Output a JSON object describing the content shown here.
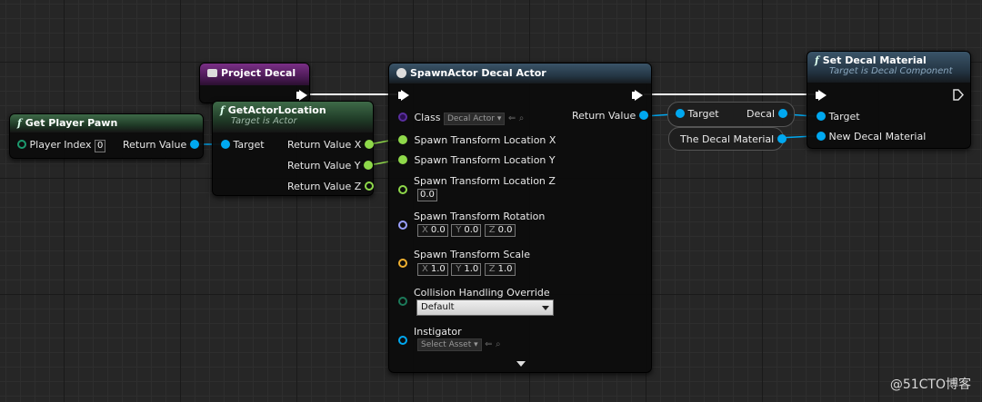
{
  "colors": {
    "exec": "#ffffff",
    "object_pin": "#00a8f0",
    "vector_pin": "#8fd94a",
    "float_pin": "#8fd94a",
    "class_pin": "#5a2ea0",
    "rotator_pin": "#9aa0ff",
    "scale_pin": "#f0b030",
    "enum_pin": "#1c7a5a"
  },
  "nodes": {
    "get_player_pawn": {
      "title": "Get Player Pawn",
      "player_index_label": "Player Index",
      "player_index_value": "0",
      "return_label": "Return Value"
    },
    "project_decal": {
      "title": "Project Decal"
    },
    "get_actor_location": {
      "title": "GetActorLocation",
      "subtitle": "Target is Actor",
      "target_label": "Target",
      "rv_x": "Return Value X",
      "rv_y": "Return Value Y",
      "rv_z": "Return Value Z"
    },
    "spawn_actor": {
      "title": "SpawnActor Decal Actor",
      "class_label": "Class",
      "class_value": "Decal Actor",
      "return_label": "Return Value",
      "loc_x": "Spawn Transform Location X",
      "loc_y": "Spawn Transform Location Y",
      "loc_z": "Spawn Transform Location Z",
      "loc_z_value": "0.0",
      "rotation_label": "Spawn Transform Rotation",
      "rot_x": "0.0",
      "rot_y": "0.0",
      "rot_z": "0.0",
      "scale_label": "Spawn Transform Scale",
      "scale_x": "1.0",
      "scale_y": "1.0",
      "scale_z": "1.0",
      "collision_label": "Collision Handling Override",
      "collision_value": "Default",
      "instigator_label": "Instigator",
      "instigator_value": "Select Asset",
      "axis_x": "X",
      "axis_y": "Y",
      "axis_z": "Z"
    },
    "decal_getter": {
      "target_label": "Target",
      "decal_label": "Decal"
    },
    "decal_material_var": {
      "label": "The Decal Material"
    },
    "set_decal_material": {
      "title": "Set Decal Material",
      "subtitle": "Target is Decal Component",
      "target_label": "Target",
      "material_label": "New Decal Material"
    }
  },
  "icons": {
    "function": "f-function-icon",
    "event": "event-icon",
    "spawn": "spawn-icon"
  },
  "watermark": "@51CTO博客"
}
